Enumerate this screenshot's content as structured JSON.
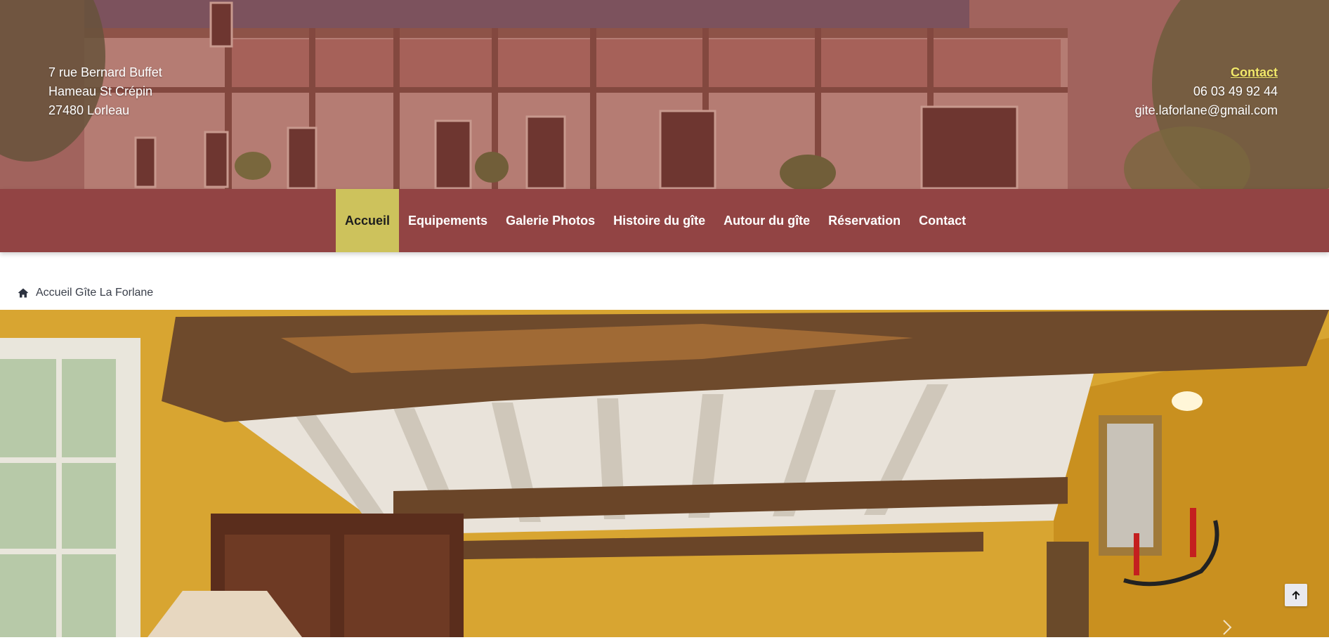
{
  "header": {
    "address": {
      "line1": "7 rue Bernard Buffet",
      "line2": "Hameau St Crépin",
      "line3": "27480 Lorleau"
    },
    "contact": {
      "link_label": "Contact",
      "phone": "06 03 49 92 44",
      "email": "gite.laforlane@gmail.com"
    }
  },
  "nav": {
    "items": [
      {
        "label": "Accueil",
        "active": true
      },
      {
        "label": "Equipements"
      },
      {
        "label": "Galerie Photos"
      },
      {
        "label": "Histoire du gîte"
      },
      {
        "label": "Autour du gîte"
      },
      {
        "label": "Réservation"
      },
      {
        "label": "Contact"
      }
    ]
  },
  "breadcrumb": {
    "icon": "home-icon",
    "label": "Accueil Gîte La Forlane"
  },
  "icons": {
    "scroll_top": "arrow-up-icon",
    "slider_next": "chevron-right-icon"
  },
  "colors": {
    "nav_bg": "#924444",
    "nav_active_bg": "#cdc25c",
    "contact_link": "#f2e86a",
    "wall_yellow": "#d8a531"
  }
}
